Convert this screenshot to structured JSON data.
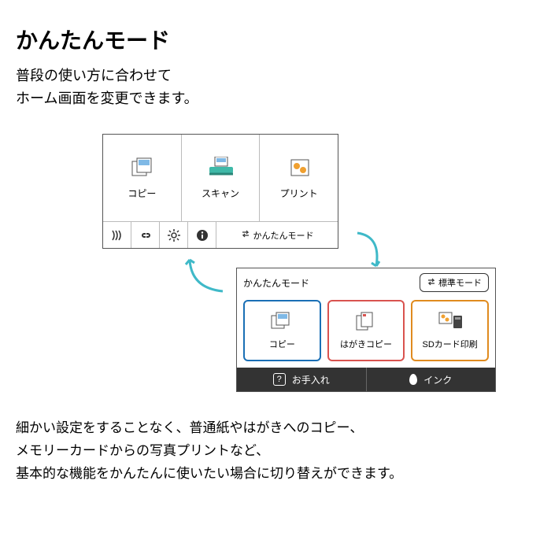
{
  "title": "かんたんモード",
  "subtitle_line1": "普段の使い方に合わせて",
  "subtitle_line2": "ホーム画面を変更できます。",
  "screen1": {
    "tiles": [
      {
        "label": "コピー"
      },
      {
        "label": "スキャン"
      },
      {
        "label": "プリント"
      }
    ],
    "mode_label": "かんたんモード"
  },
  "screen2": {
    "header_title": "かんたんモード",
    "header_button": "標準モード",
    "tiles": [
      {
        "label": "コピー",
        "border": "#1a6fb5"
      },
      {
        "label": "はがきコピー",
        "border": "#d9534f"
      },
      {
        "label": "SDカード印刷",
        "border": "#e08b1f"
      }
    ],
    "bottom": [
      {
        "label": "お手入れ"
      },
      {
        "label": "インク"
      }
    ]
  },
  "footer_line1": "細かい設定をすることなく、普通紙やはがきへのコピー、",
  "footer_line2": "メモリーカードからの写真プリントなど、",
  "footer_line3": "基本的な機能をかんたんに使いたい場合に切り替えができます。"
}
